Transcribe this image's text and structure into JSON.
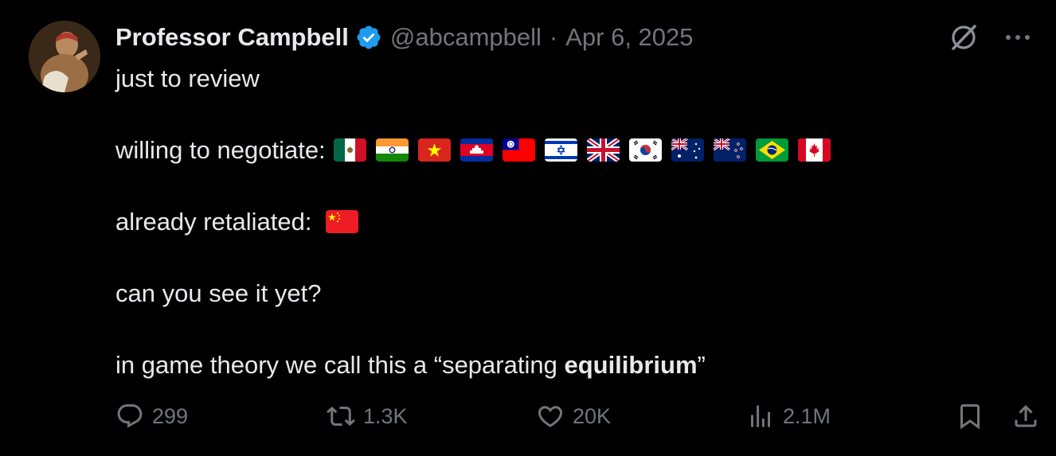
{
  "tweet": {
    "author_name": "Professor Campbell",
    "handle": "@abcampbell",
    "separator": "·",
    "date": "Apr 6, 2025",
    "lines": {
      "l1": "just to review",
      "l2": "willing to negotiate:",
      "l3": "already retaliated:",
      "l4": "can you see it yet?",
      "l5_pre": "in game theory we call this a “separating ",
      "l5_bold": "equilibrium",
      "l5_post": "”"
    },
    "negotiate_flags": [
      "mexico-flag",
      "india-flag",
      "vietnam-flag",
      "cambodia-flag",
      "taiwan-flag",
      "israel-flag",
      "uk-flag",
      "south-korea-flag",
      "australia-flag",
      "new-zealand-flag",
      "brazil-flag",
      "canada-flag"
    ],
    "retaliated_flags": [
      "china-flag"
    ]
  },
  "actions": {
    "replies": "299",
    "reposts": "1.3K",
    "likes": "20K",
    "views": "2.1M"
  },
  "colors": {
    "background": "#000000",
    "text": "#e7e9ea",
    "muted": "#71767b",
    "verified": "#1d9bf0"
  },
  "icons": [
    "verified-badge-icon",
    "grok-icon",
    "more-icon",
    "reply-icon",
    "repost-icon",
    "like-icon",
    "views-icon",
    "bookmark-icon",
    "share-icon"
  ]
}
